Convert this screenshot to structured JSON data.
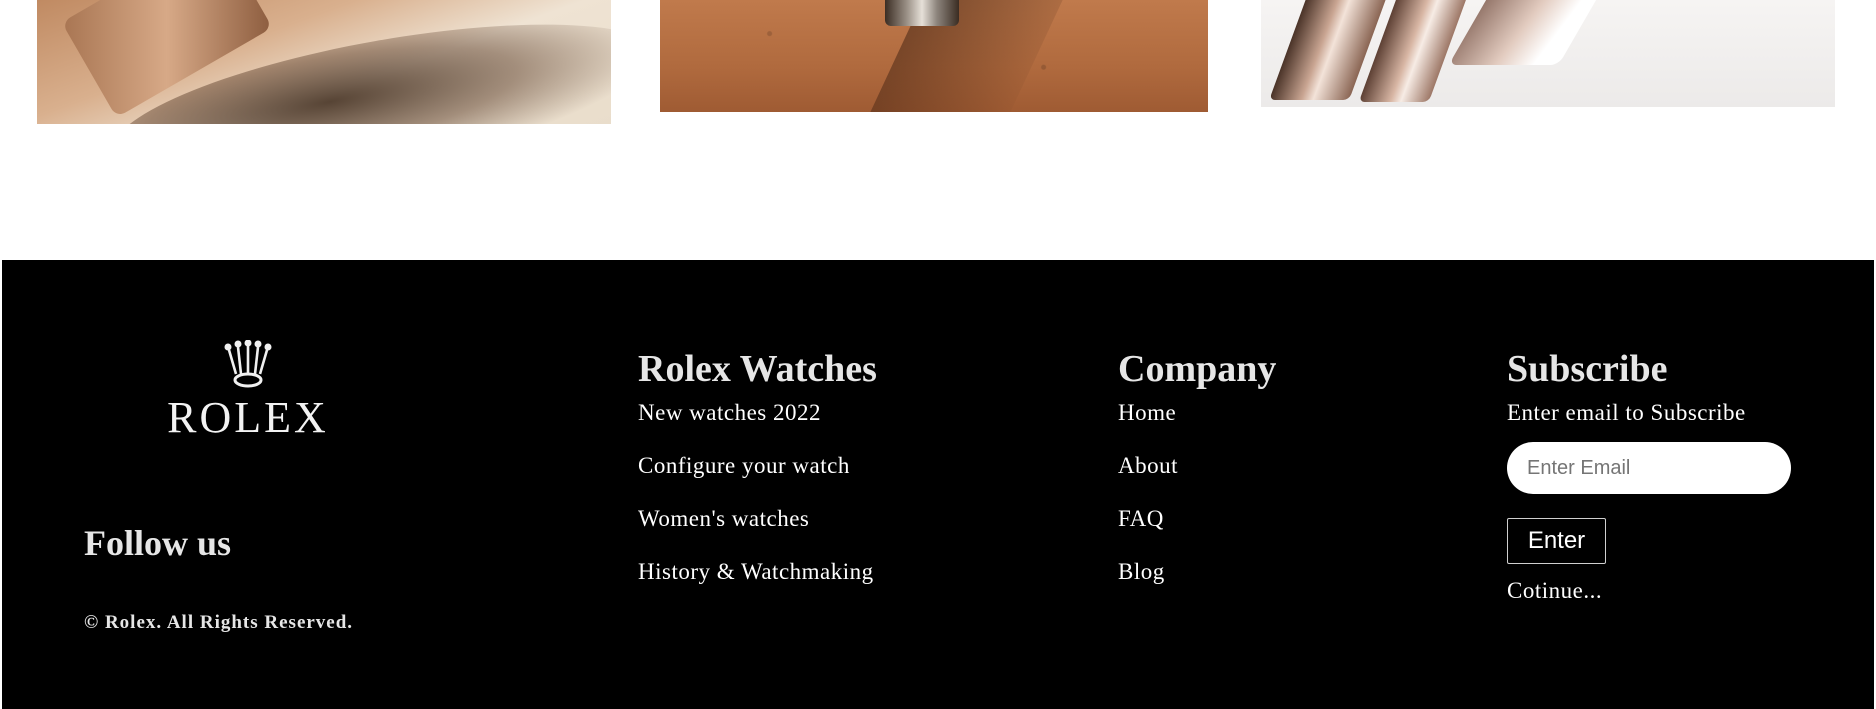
{
  "footer": {
    "logo_text": "ROLEX",
    "follow_label": "Follow us",
    "copyright": "© Rolex. All Rights Reserved.",
    "watches": {
      "heading": "Rolex Watches",
      "links": [
        "New watches 2022",
        "Configure your watch",
        "Women's watches",
        "History & Watchmaking"
      ]
    },
    "company": {
      "heading": "Company",
      "links": [
        "Home",
        "About",
        "FAQ",
        "Blog"
      ]
    },
    "subscribe": {
      "heading": "Subscribe",
      "prompt": "Enter email to Subscribe",
      "email_placeholder": "Enter Email",
      "button_label": "Enter",
      "continue_text": "Cotinue..."
    }
  },
  "colors": {
    "footer_bg": "#000000",
    "footer_text": "#ffffff",
    "heading_text": "#e6e6e6"
  }
}
